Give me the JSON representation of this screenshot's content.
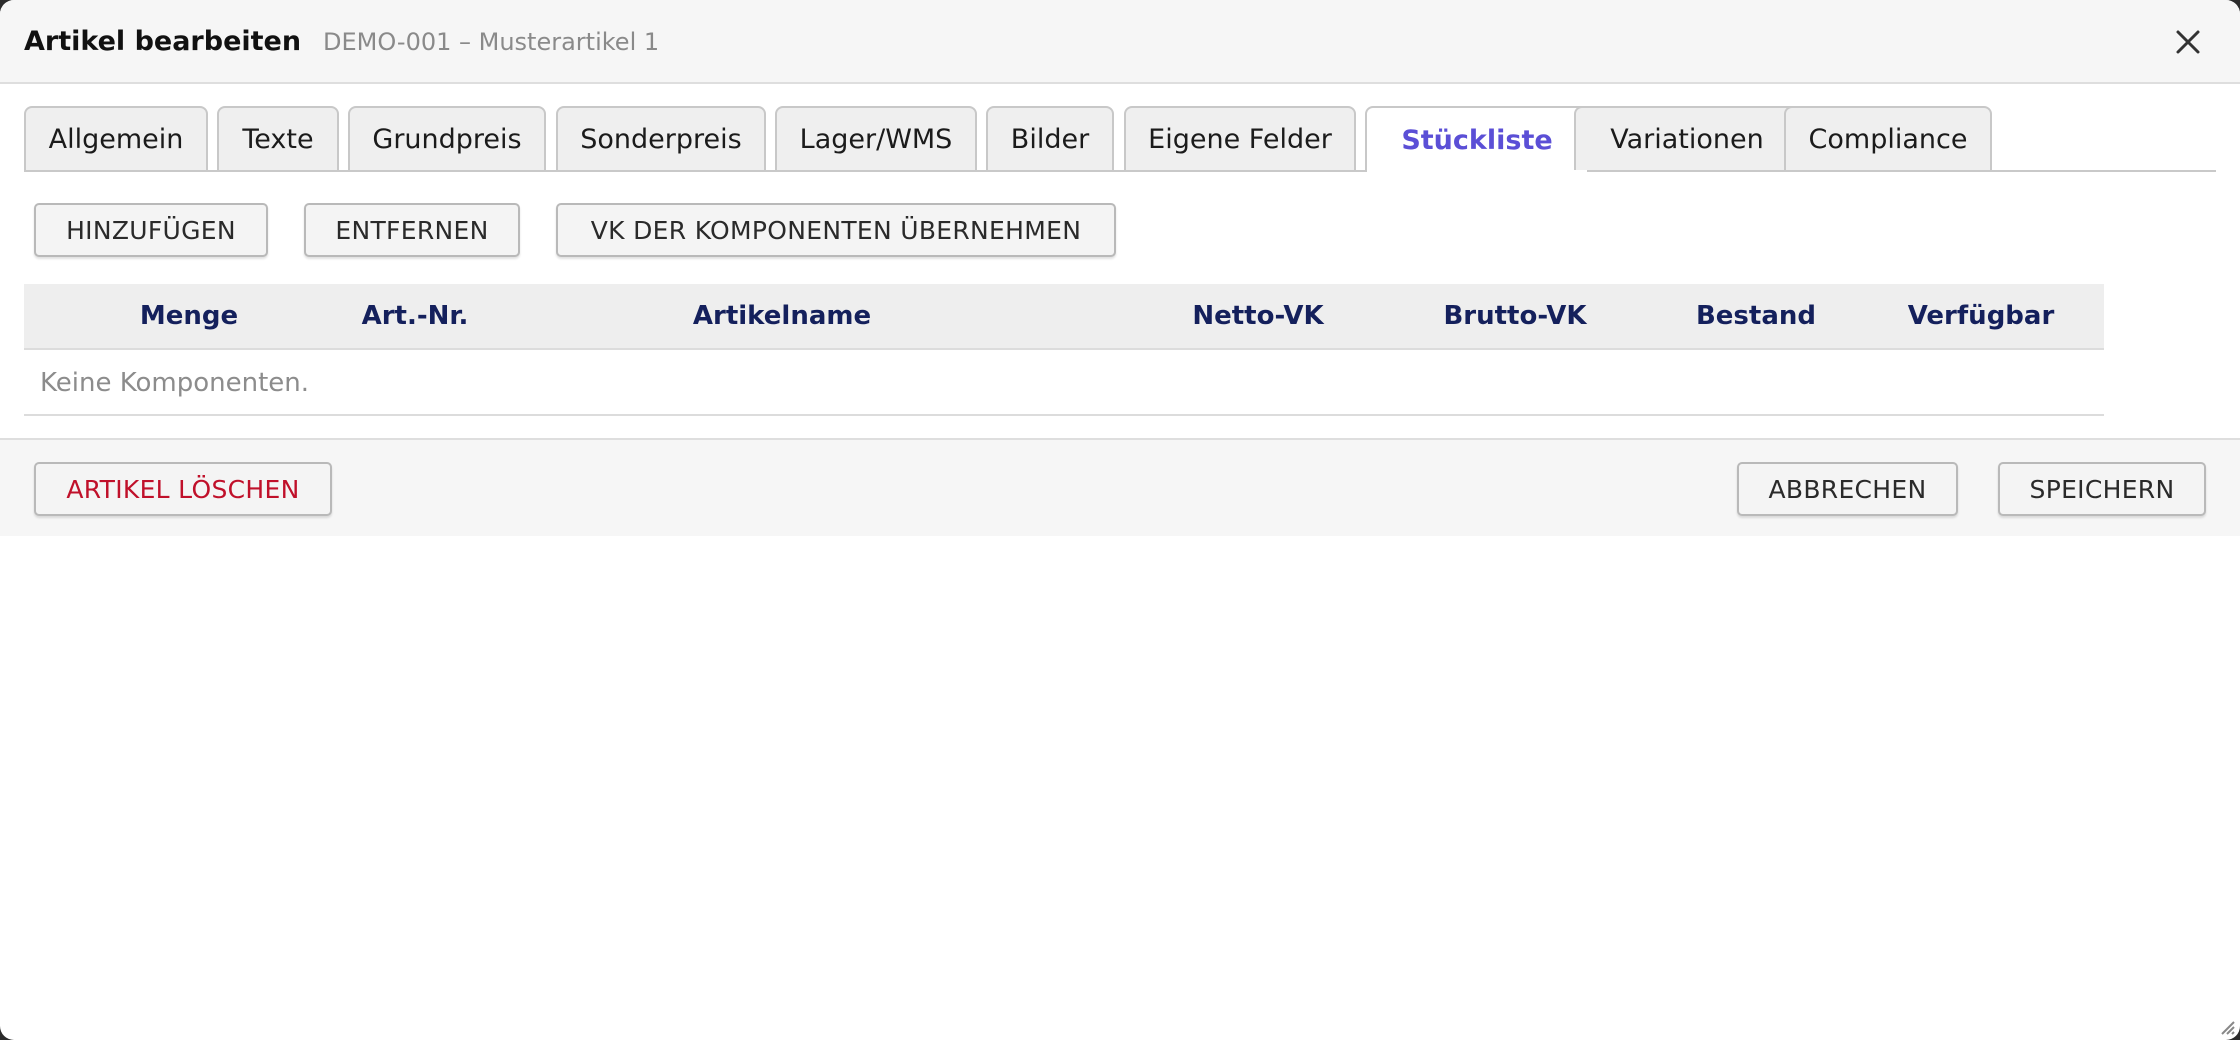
{
  "dialog": {
    "title": "Artikel bearbeiten",
    "subtitle": "DEMO-001 – Musterartikel 1",
    "close_icon": "close-icon"
  },
  "tabs": [
    {
      "label": "Allgemein",
      "active": false
    },
    {
      "label": "Texte",
      "active": false
    },
    {
      "label": "Grundpreis",
      "active": false
    },
    {
      "label": "Sonderpreis",
      "active": false
    },
    {
      "label": "Lager/WMS",
      "active": false
    },
    {
      "label": "Bilder",
      "active": false
    },
    {
      "label": "Eigene Felder",
      "active": false
    },
    {
      "label": "Stückliste",
      "active": true
    },
    {
      "label": "Variationen",
      "active": false
    },
    {
      "label": "Compliance",
      "active": false
    }
  ],
  "toolbar": {
    "add_label": "HINZUFÜGEN",
    "remove_label": "ENTFERNEN",
    "apply_vk_label": "VK DER KOMPONENTEN ÜBERNEHMEN"
  },
  "table": {
    "columns": [
      "Menge",
      "Art.-Nr.",
      "Artikelname",
      "Netto-VK",
      "Brutto-VK",
      "Bestand",
      "Verfügbar"
    ],
    "empty_text": "Keine Komponenten."
  },
  "footer": {
    "delete_label": "ARTIKEL LÖSCHEN",
    "cancel_label": "ABBRECHEN",
    "save_label": "SPEICHERN"
  },
  "colors": {
    "accent_tab": "#5b4fd6",
    "header_text": "#14205c",
    "danger": "#c0102a"
  }
}
